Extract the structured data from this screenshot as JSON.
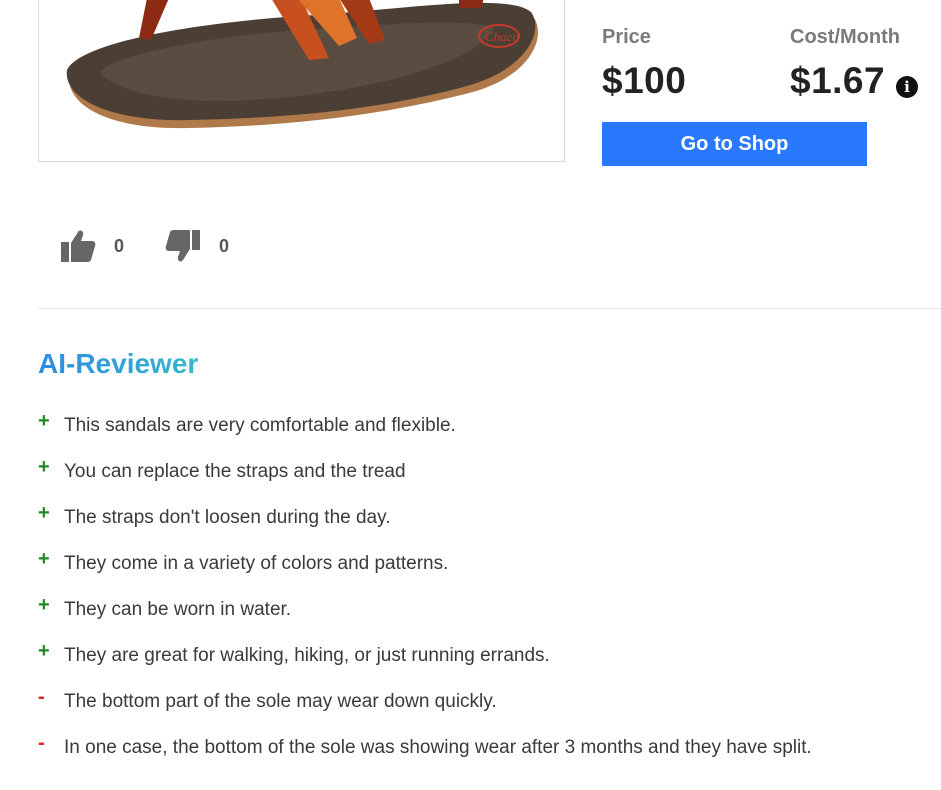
{
  "product": {
    "image_alt": "sandal-photo"
  },
  "pricing": {
    "price_label": "Price",
    "price_value": "$100",
    "cost_label": "Cost/Month",
    "cost_value": "$1.67",
    "info_icon": "info-icon"
  },
  "shop_button": {
    "label": "Go to Shop",
    "color": "#2979ff"
  },
  "votes": {
    "up_icon": "thumbs-up-icon",
    "up_count": "0",
    "down_icon": "thumbs-down-icon",
    "down_count": "0"
  },
  "ai_reviewer": {
    "title": "AI-Reviewer",
    "items": [
      {
        "type": "pro",
        "marker": "+",
        "text": "This sandals are very comfortable and flexible."
      },
      {
        "type": "pro",
        "marker": "+",
        "text": "You can replace the straps and the tread"
      },
      {
        "type": "pro",
        "marker": "+",
        "text": "The straps don't loosen during the day."
      },
      {
        "type": "pro",
        "marker": "+",
        "text": "They come in a variety of colors and patterns."
      },
      {
        "type": "pro",
        "marker": "+",
        "text": "They can be worn in water."
      },
      {
        "type": "pro",
        "marker": "+",
        "text": "They are great for walking, hiking, or just running errands."
      },
      {
        "type": "con",
        "marker": "-",
        "text": "The bottom part of the sole may wear down quickly."
      },
      {
        "type": "con",
        "marker": "-",
        "text": "In one case, the bottom of the sole was showing wear after 3 months and they have split."
      }
    ]
  },
  "colors": {
    "pro": "#1f8a1f",
    "con": "#e02020",
    "accent_start": "#2d8be3",
    "accent_end": "#35b8c9"
  }
}
